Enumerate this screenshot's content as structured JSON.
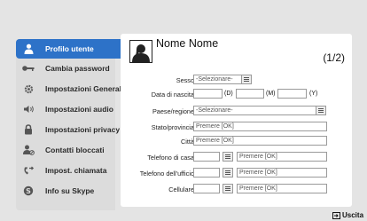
{
  "sidebar": {
    "items": [
      {
        "label": "Profilo utente",
        "icon": "user-icon"
      },
      {
        "label": "Cambia password",
        "icon": "key-icon"
      },
      {
        "label": "Impostazioni Generali",
        "icon": "gear-icon"
      },
      {
        "label": "Impostazioni audio",
        "icon": "speaker-icon"
      },
      {
        "label": "Impostazioni privacy",
        "icon": "lock-icon"
      },
      {
        "label": "Contatti bloccati",
        "icon": "blocked-contact-icon"
      },
      {
        "label": "Impost. chiamata",
        "icon": "call-forward-icon"
      },
      {
        "label": "Info su Skype",
        "icon": "skype-icon"
      }
    ],
    "active_index": 0,
    "accent": "#2d72c8"
  },
  "profile": {
    "name": "Nome Nome",
    "page_indicator": "(1/2)"
  },
  "form": {
    "sesso": {
      "label": "Sesso",
      "value": "-Selezionare-"
    },
    "data_nascita": {
      "label": "Data di nascita",
      "day_unit": "(D)",
      "month_unit": "(M)",
      "year_unit": "(Y)"
    },
    "paese": {
      "label": "Paese/regione",
      "value": "-Selezionare-"
    },
    "stato": {
      "label": "Stato/provincia",
      "value": "Premere [OK]"
    },
    "citta": {
      "label": "Città",
      "value": "Premere [OK]"
    },
    "tel_casa": {
      "label": "Telefono di casa",
      "value": "Premere [OK]"
    },
    "tel_ufficio": {
      "label": "Telefono dell'ufficio",
      "value": "Premere [OK]"
    },
    "cellulare": {
      "label": "Cellulare",
      "value": "Premere [OK]"
    }
  },
  "footer": {
    "exit_label": "Uscita"
  }
}
